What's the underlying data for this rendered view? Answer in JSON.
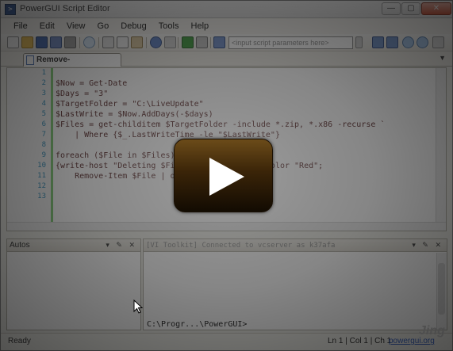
{
  "window": {
    "title": "PowerGUI Script Editor",
    "controls": [
      "—",
      "▢",
      "✕"
    ]
  },
  "menu": {
    "items": [
      "File",
      "Edit",
      "View",
      "Go",
      "Debug",
      "Tools",
      "Help"
    ]
  },
  "toolbar": {
    "params_placeholder": "<input script parameters here>"
  },
  "tab": {
    "label": "Remove-Li..._days.ps1"
  },
  "editor": {
    "line_numbers": [
      "1",
      "2",
      "3",
      "4",
      "5",
      "6",
      "7",
      "8",
      "9",
      "10",
      "11",
      "12",
      "13"
    ],
    "lines": [
      "",
      "$Now = Get-Date",
      "$Days = \"3\"",
      "$TargetFolder = \"C:\\LiveUpdate\"",
      "$LastWrite = $Now.AddDays(-$days)",
      "$Files = get-childitem $TargetFolder -include *.zip, *.x86 -recurse `",
      "    | Where {$_.LastWriteTime -le \"$LastWrite\"}",
      "",
      "foreach ($File in $Files)",
      "{write-host \"Deleting $File ...\" -foregroundcolor \"Red\";",
      "    Remove-Item $File | out-null}",
      "",
      ""
    ]
  },
  "autos": {
    "title": "Autos"
  },
  "console": {
    "status": "[VI Toolkit] Connected to vcserver as k37afa",
    "prompt": "C:\\Progr...\\PowerGUI>"
  },
  "statusbar": {
    "ready": "Ready",
    "position": "Ln 1 | Col 1 | Ch 1",
    "link": "powergui.org",
    "watermark": "Jing"
  },
  "icons": {
    "play": "play-icon"
  }
}
